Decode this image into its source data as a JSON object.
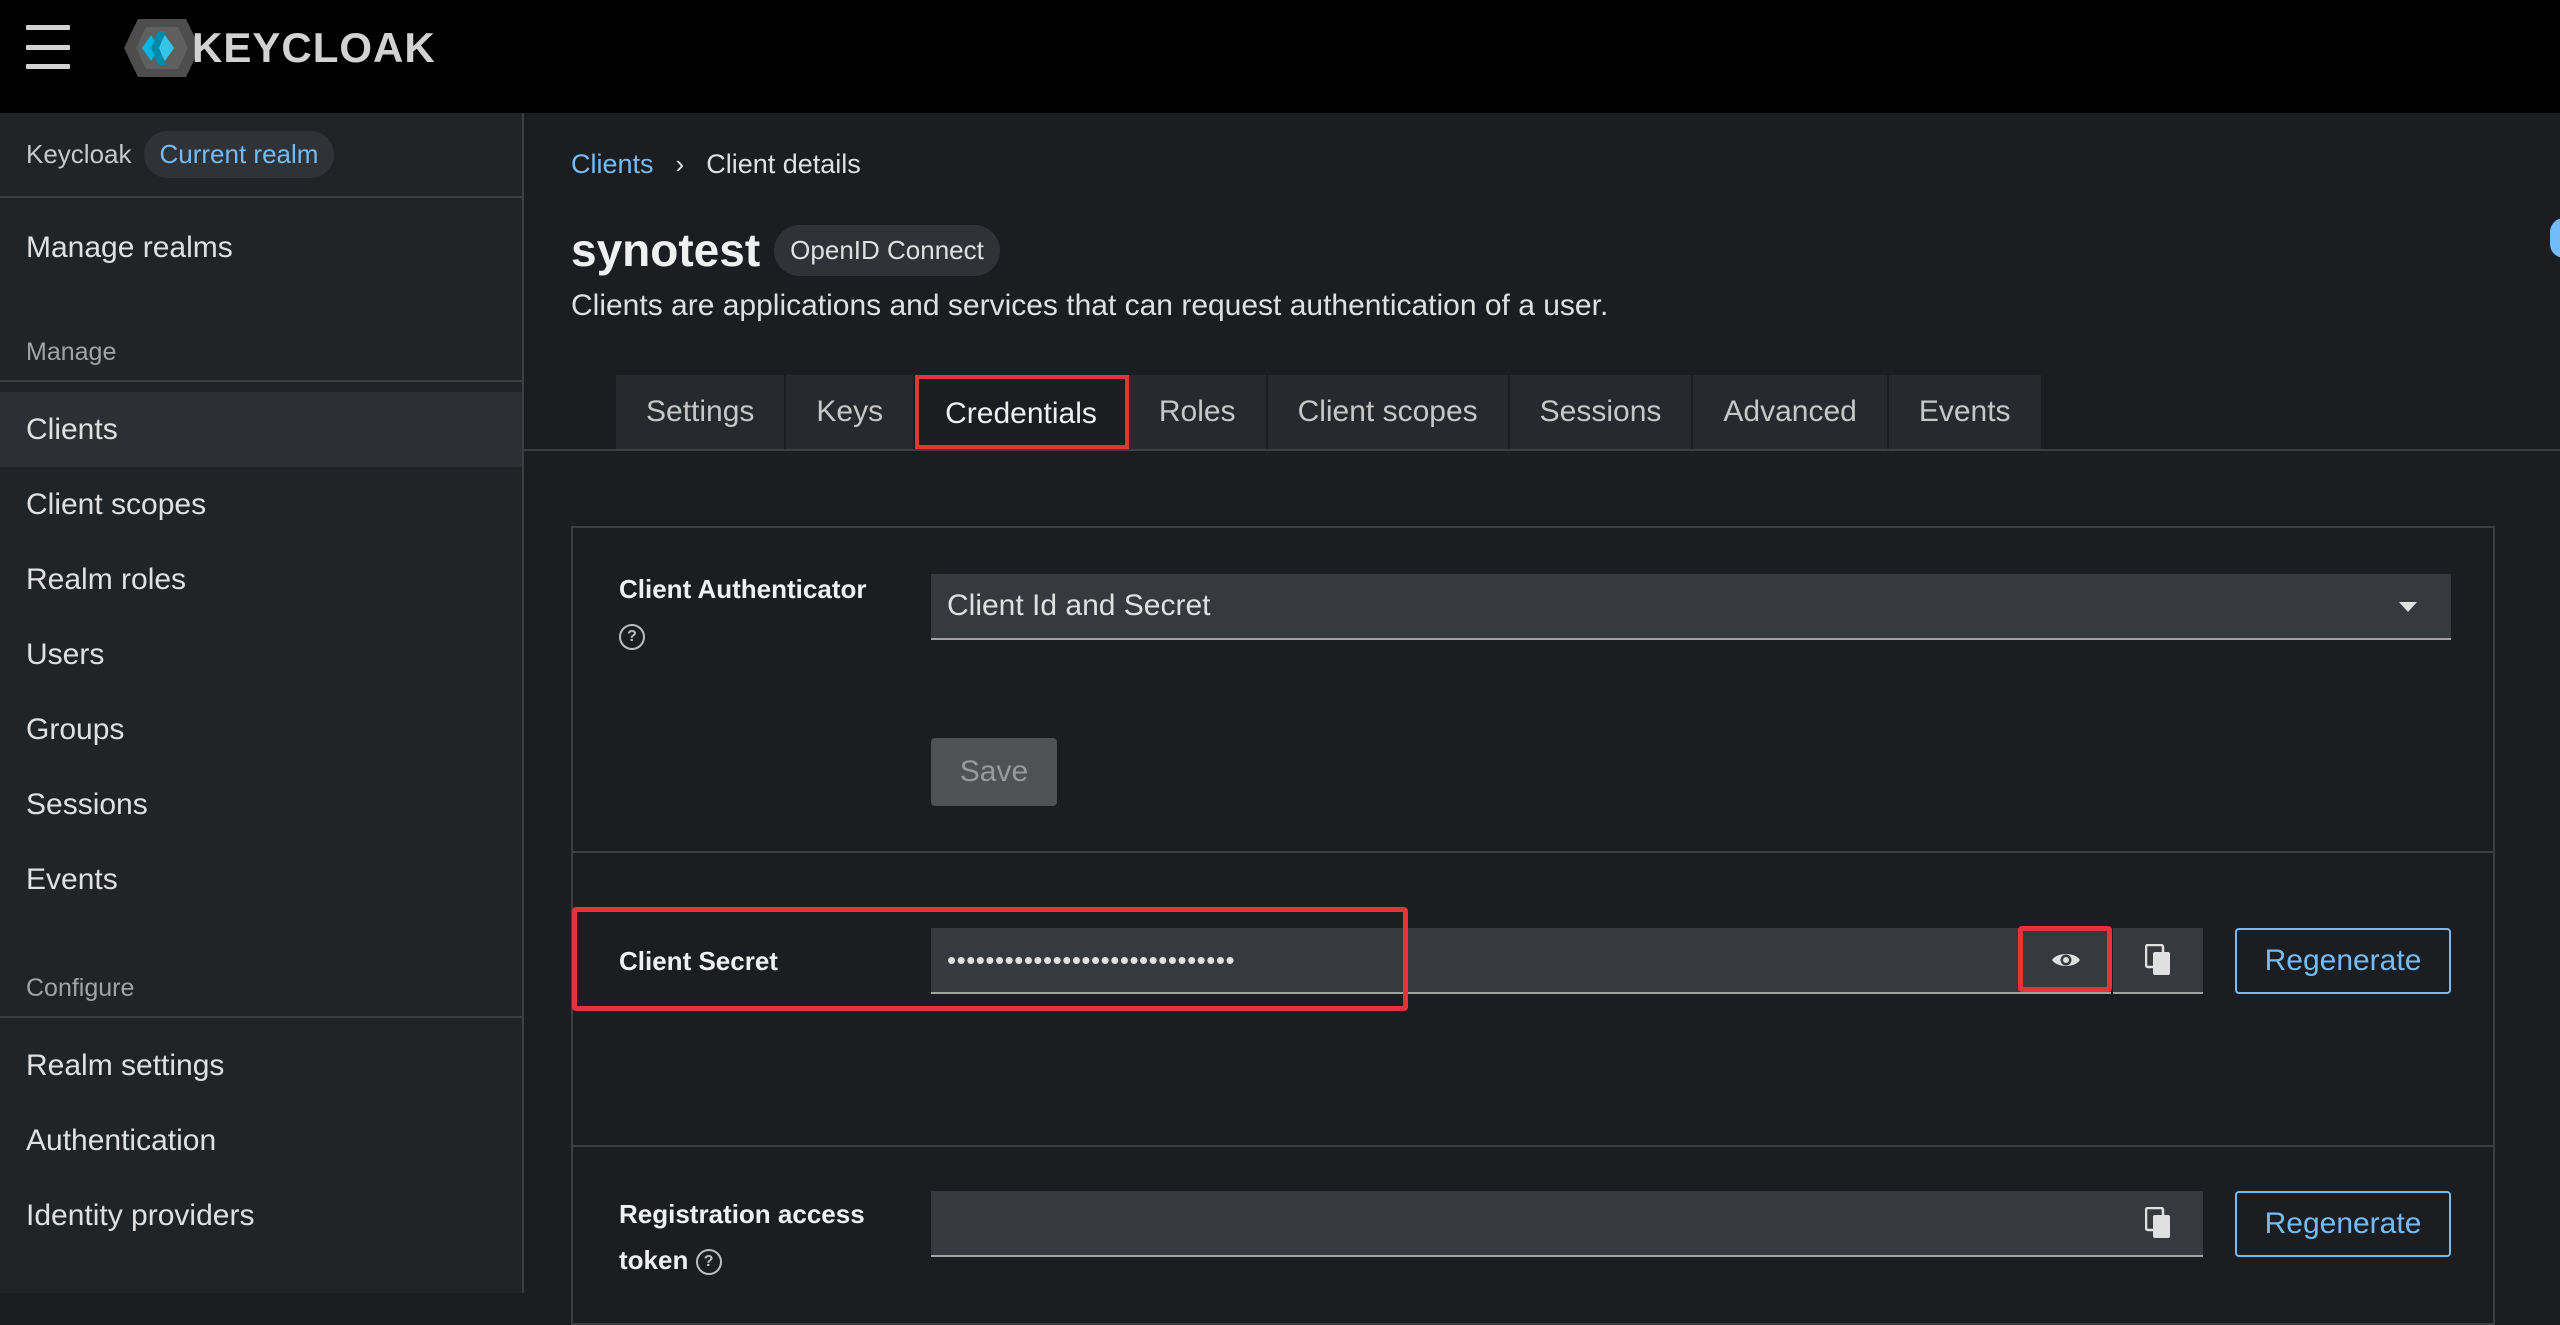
{
  "masthead": {
    "brand": "KEYCLOAK",
    "menu_icon": "hamburger-menu-icon",
    "logo_icon": "keycloak-logo-icon"
  },
  "sidebar": {
    "realm_name": "Keycloak",
    "realm_badge": "Current realm",
    "manage_realms": "Manage realms",
    "manage_section": "Manage",
    "manage_items": [
      "Clients",
      "Client scopes",
      "Realm roles",
      "Users",
      "Groups",
      "Sessions",
      "Events"
    ],
    "configure_section": "Configure",
    "configure_items": [
      "Realm settings",
      "Authentication",
      "Identity providers"
    ]
  },
  "breadcrumb": {
    "parent": "Clients",
    "current": "Client details",
    "separator_icon": "chevron-right-icon"
  },
  "page": {
    "title": "synotest",
    "protocol": "OpenID Connect",
    "description": "Clients are applications and services that can request authentication of a user."
  },
  "tabs": [
    "Settings",
    "Keys",
    "Credentials",
    "Roles",
    "Client scopes",
    "Sessions",
    "Advanced",
    "Events"
  ],
  "credentials": {
    "authenticator_label": "Client Authenticator",
    "authenticator_value": "Client Id and Secret",
    "save_label": "Save",
    "secret_label": "Client Secret",
    "secret_value": "••••••••••••••••••••••••••••••",
    "show_icon": "eye-icon",
    "copy_icon": "copy-icon",
    "regenerate_label": "Regenerate",
    "registration_label": "Registration access token",
    "registration_value": "",
    "registration_regenerate_label": "Regenerate"
  },
  "colors": {
    "accent": "#73bcf7",
    "highlight": "#e2353b",
    "masthead": "#000000",
    "background": "#1b1d21"
  }
}
